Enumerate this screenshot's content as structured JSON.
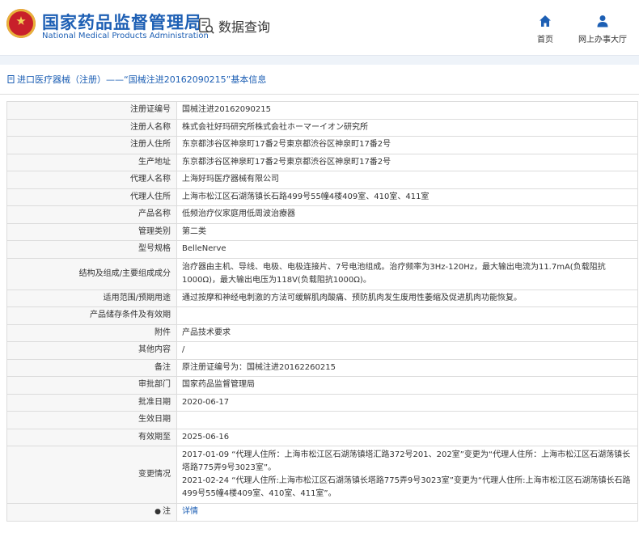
{
  "header": {
    "brand_cn": "国家药品监督管理局",
    "brand_en": "National Medical Products Administration",
    "query_label": "数据查询",
    "nav": [
      {
        "label": "首页",
        "icon": "home-icon"
      },
      {
        "label": "网上办事大厅",
        "icon": "user-icon"
      }
    ]
  },
  "breadcrumb": {
    "link": "进口医疗器械（注册）",
    "separator": "——",
    "title": "“国械注进20162090215”基本信息"
  },
  "record": {
    "rows": [
      {
        "label": "注册证编号",
        "value": "国械注进20162090215"
      },
      {
        "label": "注册人名称",
        "value": "株式会社好玛研究所株式会社ホーマーイオン研究所"
      },
      {
        "label": "注册人住所",
        "value": "东京都涉谷区神泉町17番2号東京都渋谷区神泉町17番2号"
      },
      {
        "label": "生产地址",
        "value": "东京都涉谷区神泉町17番2号東京都渋谷区神泉町17番2号"
      },
      {
        "label": "代理人名称",
        "value": "上海好玛医疗器械有限公司"
      },
      {
        "label": "代理人住所",
        "value": "上海市松江区石湖荡镇长石路499号55幢4楼409室、410室、411室"
      },
      {
        "label": "产品名称",
        "value": "低频治疗仪家庭用低周波治療器"
      },
      {
        "label": "管理类别",
        "value": "第二类"
      },
      {
        "label": "型号规格",
        "value": "BelleNerve"
      },
      {
        "label": "结构及组成/主要组成成分",
        "value": "治疗器由主机、导线、电极、电极连接片、7号电池组成。治疗频率为3Hz-120Hz，最大输出电流为11.7mA(负载阻抗1000Ω)，最大输出电压为118V(负载阻抗1000Ω)。"
      },
      {
        "label": "适用范围/预期用途",
        "value": "通过按摩和神经电刺激的方法可缓解肌肉酸痛、预防肌肉发生废用性萎缩及促进肌肉功能恢复。"
      },
      {
        "label": "产品储存条件及有效期",
        "value": ""
      },
      {
        "label": "附件",
        "value": "产品技术要求"
      },
      {
        "label": "其他内容",
        "value": "/"
      },
      {
        "label": "备注",
        "value": "原注册证编号为：国械注进20162260215"
      },
      {
        "label": "审批部门",
        "value": "国家药品监督管理局"
      },
      {
        "label": "批准日期",
        "value": "2020-06-17"
      },
      {
        "label": "生效日期",
        "value": ""
      },
      {
        "label": "有效期至",
        "value": "2025-06-16"
      }
    ],
    "changes_label": "变更情况",
    "changes": [
      "2017-01-09 “代理人住所：上海市松江区石湖荡镇塔汇路372号201、202室”变更为“代理人住所：上海市松江区石湖荡镇长塔路775弄9号3023室”。",
      "2021-02-24 “代理人住所:上海市松江区石湖荡镇长塔路775弄9号3023室”变更为“代理人住所:上海市松江区石湖荡镇长石路499号55幢4楼409室、410室、411室”。"
    ],
    "note_label": "注",
    "note_link": "详情"
  }
}
